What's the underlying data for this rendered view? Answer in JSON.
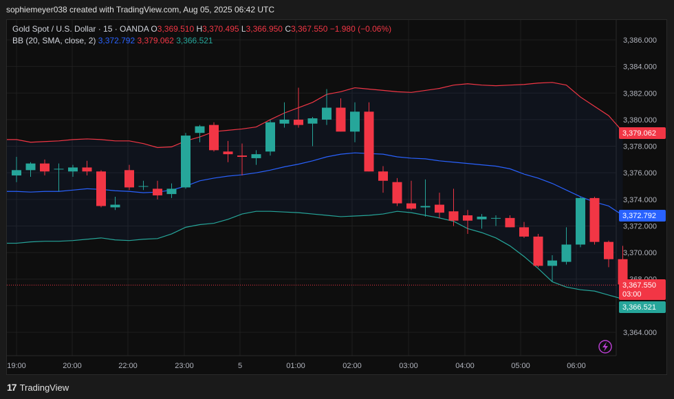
{
  "header": {
    "attribution": "sophiemeyer038 created with TradingView.com, Aug 05, 2025 06:42 UTC"
  },
  "legend": {
    "symbol": "Gold Spot / U.S. Dollar · 15 · OANDA",
    "o_label": "O",
    "o_value": "3,369.510",
    "h_label": "H",
    "h_value": "3,370.495",
    "l_label": "L",
    "l_value": "3,366.950",
    "c_label": "C",
    "c_value": "3,367.550",
    "change": "−1.980 (−0.06%)",
    "bb_label": "BB (20, SMA, close, 2)",
    "bb_basis": "3,372.792",
    "bb_upper": "3,379.062",
    "bb_lower": "3,366.521"
  },
  "footer": {
    "brand": "TradingView"
  },
  "colors": {
    "up": "#26a69a",
    "down": "#f23645",
    "basis": "#2962ff",
    "upper": "#f23645",
    "lower": "#26a69a"
  },
  "chart_data": {
    "type": "candlestick",
    "title": "Gold Spot / U.S. Dollar · 15 · OANDA",
    "ylim": [
      3363,
      3387
    ],
    "y_ticks": [
      "3,386.000",
      "3,384.000",
      "3,382.000",
      "3,380.000",
      "3,378.000",
      "3,376.000",
      "3,374.000",
      "3,372.000",
      "3,370.000",
      "3,368.000",
      "3,366.000",
      "3,364.000"
    ],
    "x_ticks": [
      "19:00",
      "20:00",
      "22:00",
      "23:00",
      "5",
      "01:00",
      "02:00",
      "03:00",
      "04:00",
      "05:00",
      "06:00"
    ],
    "price_labels": [
      {
        "name": "upper",
        "value": "3,379.062"
      },
      {
        "name": "basis",
        "value": "3,372.792"
      },
      {
        "name": "last",
        "value": "3,367.550",
        "countdown": "03:00"
      },
      {
        "name": "lower",
        "value": "3,366.521"
      }
    ],
    "candles": [
      {
        "o": 3375.8,
        "h": 3377.2,
        "l": 3375.3,
        "c": 3376.2
      },
      {
        "o": 3376.2,
        "h": 3376.8,
        "l": 3375.7,
        "c": 3376.7
      },
      {
        "o": 3376.7,
        "h": 3377.0,
        "l": 3375.8,
        "c": 3376.1
      },
      {
        "o": 3376.3,
        "h": 3376.7,
        "l": 3374.6,
        "c": 3376.3
      },
      {
        "o": 3376.1,
        "h": 3376.6,
        "l": 3375.7,
        "c": 3376.4
      },
      {
        "o": 3376.4,
        "h": 3376.9,
        "l": 3375.8,
        "c": 3376.1
      },
      {
        "o": 3376.1,
        "h": 3376.2,
        "l": 3373.4,
        "c": 3373.5
      },
      {
        "o": 3373.4,
        "h": 3374.2,
        "l": 3373.2,
        "c": 3373.6
      },
      {
        "o": 3376.2,
        "h": 3376.6,
        "l": 3374.7,
        "c": 3374.9
      },
      {
        "o": 3375.0,
        "h": 3375.4,
        "l": 3374.7,
        "c": 3375.0
      },
      {
        "o": 3374.8,
        "h": 3375.4,
        "l": 3374.0,
        "c": 3374.3
      },
      {
        "o": 3374.4,
        "h": 3375.2,
        "l": 3374.1,
        "c": 3374.8
      },
      {
        "o": 3374.9,
        "h": 3379.0,
        "l": 3374.8,
        "c": 3378.8
      },
      {
        "o": 3379.0,
        "h": 3379.6,
        "l": 3378.3,
        "c": 3379.5
      },
      {
        "o": 3379.6,
        "h": 3379.8,
        "l": 3377.6,
        "c": 3377.7
      },
      {
        "o": 3377.6,
        "h": 3378.4,
        "l": 3376.8,
        "c": 3377.4
      },
      {
        "o": 3377.3,
        "h": 3378.2,
        "l": 3375.8,
        "c": 3377.2
      },
      {
        "o": 3377.1,
        "h": 3377.7,
        "l": 3376.6,
        "c": 3377.4
      },
      {
        "o": 3377.6,
        "h": 3380.0,
        "l": 3377.3,
        "c": 3379.8
      },
      {
        "o": 3379.7,
        "h": 3381.3,
        "l": 3379.4,
        "c": 3380.0
      },
      {
        "o": 3380.0,
        "h": 3382.4,
        "l": 3379.4,
        "c": 3379.6
      },
      {
        "o": 3379.7,
        "h": 3380.2,
        "l": 3378.0,
        "c": 3380.1
      },
      {
        "o": 3380.0,
        "h": 3382.3,
        "l": 3379.6,
        "c": 3380.9
      },
      {
        "o": 3380.9,
        "h": 3381.6,
        "l": 3379.1,
        "c": 3379.1
      },
      {
        "o": 3379.1,
        "h": 3381.3,
        "l": 3378.3,
        "c": 3380.6
      },
      {
        "o": 3380.6,
        "h": 3381.3,
        "l": 3376.1,
        "c": 3376.1
      },
      {
        "o": 3376.1,
        "h": 3376.5,
        "l": 3374.5,
        "c": 3375.4
      },
      {
        "o": 3375.3,
        "h": 3375.6,
        "l": 3373.5,
        "c": 3373.7
      },
      {
        "o": 3373.7,
        "h": 3375.4,
        "l": 3373.2,
        "c": 3373.3
      },
      {
        "o": 3373.4,
        "h": 3375.5,
        "l": 3372.7,
        "c": 3373.5
      },
      {
        "o": 3373.6,
        "h": 3374.5,
        "l": 3372.6,
        "c": 3373.0
      },
      {
        "o": 3373.1,
        "h": 3374.8,
        "l": 3372.0,
        "c": 3372.4
      },
      {
        "o": 3372.8,
        "h": 3373.2,
        "l": 3371.4,
        "c": 3372.4
      },
      {
        "o": 3372.5,
        "h": 3372.9,
        "l": 3371.8,
        "c": 3372.7
      },
      {
        "o": 3372.6,
        "h": 3372.8,
        "l": 3372.0,
        "c": 3372.6
      },
      {
        "o": 3372.6,
        "h": 3372.8,
        "l": 3371.9,
        "c": 3371.9
      },
      {
        "o": 3371.9,
        "h": 3372.3,
        "l": 3371.1,
        "c": 3371.2
      },
      {
        "o": 3371.2,
        "h": 3371.4,
        "l": 3368.9,
        "c": 3369.0
      },
      {
        "o": 3369.0,
        "h": 3369.8,
        "l": 3367.8,
        "c": 3369.4
      },
      {
        "o": 3369.3,
        "h": 3371.9,
        "l": 3369.1,
        "c": 3370.6
      },
      {
        "o": 3370.6,
        "h": 3374.2,
        "l": 3370.4,
        "c": 3374.1
      },
      {
        "o": 3374.1,
        "h": 3374.2,
        "l": 3370.6,
        "c": 3370.8
      },
      {
        "o": 3370.8,
        "h": 3370.9,
        "l": 3368.9,
        "c": 3369.5
      },
      {
        "o": 3369.5,
        "h": 3370.5,
        "l": 3367.0,
        "c": 3367.6
      }
    ],
    "upper_band": [
      3378.5,
      3378.3,
      3378.35,
      3378.4,
      3378.5,
      3378.55,
      3378.5,
      3378.4,
      3378.4,
      3378.2,
      3377.9,
      3377.95,
      3378.4,
      3378.7,
      3379.1,
      3379.2,
      3379.3,
      3379.45,
      3380.0,
      3380.5,
      3380.9,
      3381.3,
      3381.9,
      3382.1,
      3382.4,
      3382.3,
      3382.2,
      3382.1,
      3382.05,
      3382.2,
      3382.35,
      3382.6,
      3382.7,
      3382.6,
      3382.55,
      3382.6,
      3382.65,
      3382.75,
      3382.8,
      3382.6,
      3381.7,
      3381.0,
      3380.3,
      3379.1
    ],
    "basis_line": [
      3374.6,
      3374.55,
      3374.6,
      3374.6,
      3374.7,
      3374.8,
      3374.75,
      3374.65,
      3374.6,
      3374.5,
      3374.55,
      3374.7,
      3375.0,
      3375.4,
      3375.6,
      3375.75,
      3375.85,
      3376.0,
      3376.2,
      3376.45,
      3376.65,
      3376.9,
      3377.2,
      3377.4,
      3377.5,
      3377.45,
      3377.4,
      3377.2,
      3377.1,
      3377.05,
      3376.9,
      3376.8,
      3376.7,
      3376.6,
      3376.5,
      3376.3,
      3375.9,
      3375.6,
      3375.2,
      3374.7,
      3374.2,
      3373.8,
      3373.5,
      3372.8
    ],
    "lower_band": [
      3370.7,
      3370.8,
      3370.85,
      3370.85,
      3370.9,
      3371.0,
      3371.1,
      3370.95,
      3370.9,
      3371.0,
      3371.05,
      3371.4,
      3371.9,
      3372.1,
      3372.2,
      3372.5,
      3372.9,
      3373.1,
      3373.1,
      3373.05,
      3373.0,
      3372.9,
      3372.8,
      3372.7,
      3372.75,
      3372.8,
      3372.9,
      3373.1,
      3373.0,
      3372.8,
      3372.6,
      3372.35,
      3371.8,
      3371.5,
      3371.1,
      3370.5,
      3369.7,
      3368.8,
      3367.8,
      3367.4,
      3367.2,
      3367.1,
      3366.8,
      3366.5
    ],
    "last_price": 3367.55
  }
}
